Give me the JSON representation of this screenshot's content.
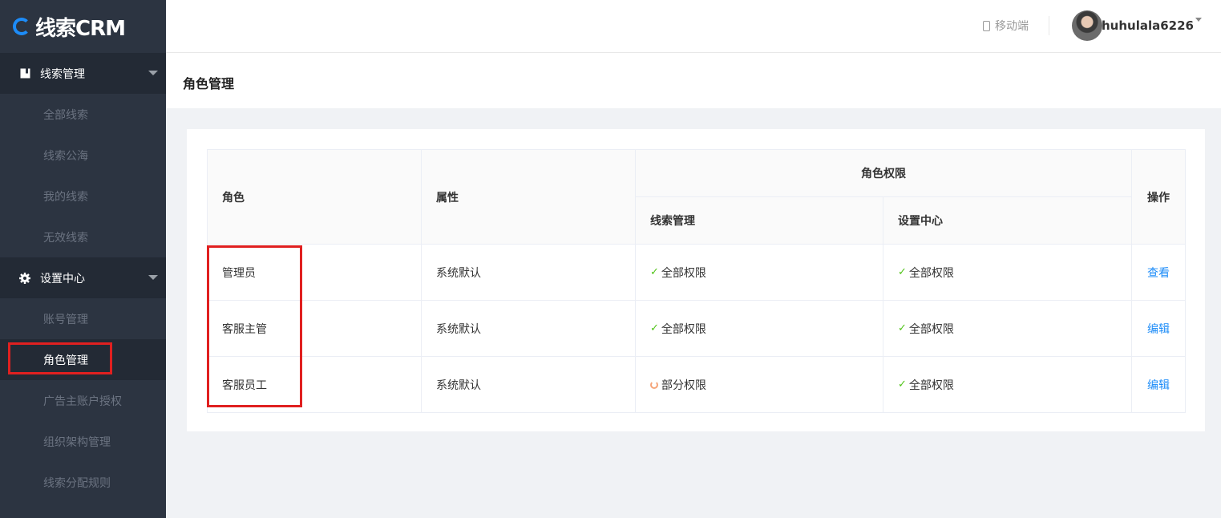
{
  "app": {
    "logo_text": "线索CRM",
    "brand_color": "#1d8cf8"
  },
  "sidebar": {
    "groups": [
      {
        "label": "线索管理",
        "icon": "book-icon",
        "items": [
          "全部线索",
          "线索公海",
          "我的线索",
          "无效线索"
        ]
      },
      {
        "label": "设置中心",
        "icon": "gear-icon",
        "items": [
          "账号管理",
          "角色管理",
          "广告主账户授权",
          "组织架构管理",
          "线索分配规则"
        ],
        "active_item": "角色管理"
      }
    ]
  },
  "header": {
    "mobile_label": "移动端",
    "username": "huhulala6226"
  },
  "page": {
    "title": "角色管理"
  },
  "table": {
    "headers": {
      "role": "角色",
      "attribute": "属性",
      "permissions": "角色权限",
      "clue_mgmt": "线索管理",
      "settings_center": "设置中心",
      "action": "操作"
    },
    "rows": [
      {
        "role": "管理员",
        "attribute": "系统默认",
        "clue_mgmt": "全部权限",
        "clue_mgmt_status": "full",
        "settings": "全部权限",
        "settings_status": "full",
        "action": "查看"
      },
      {
        "role": "客服主管",
        "attribute": "系统默认",
        "clue_mgmt": "全部权限",
        "clue_mgmt_status": "full",
        "settings": "全部权限",
        "settings_status": "full",
        "action": "编辑"
      },
      {
        "role": "客服员工",
        "attribute": "系统默认",
        "clue_mgmt": "部分权限",
        "clue_mgmt_status": "partial",
        "settings": "全部权限",
        "settings_status": "full",
        "action": "编辑"
      }
    ]
  },
  "colors": {
    "sidebar_bg": "#2c3441",
    "highlight": "#e02020",
    "check": "#52c41a",
    "partial": "#f5a57a",
    "link": "#1d8cf8"
  }
}
